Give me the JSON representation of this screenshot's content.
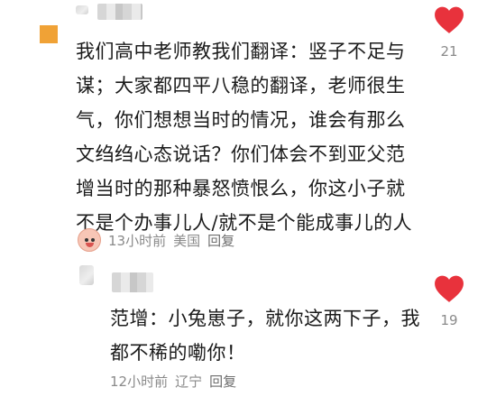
{
  "comments": [
    {
      "text": "我们高中老师教我们翻译：竖子不足与\n谋；大家都四平八稳的翻译，老师很生\n气，你们想想当时的情况，谁会有那么\n文绉绉心态说话？你们体会不到亚父范\n增当时的那种暴怒愤恨么，你这小子就\n不是个办事儿人/就不是个能成事儿的人",
      "time": "13小时前",
      "location": "美国",
      "reply_label": "回复",
      "likes": "21"
    },
    {
      "text": "范增：小兔崽子，就你这两下子，我\n都不稀的嘞你！",
      "time": "12小时前",
      "location": "辽宁",
      "reply_label": "回复",
      "likes": "19"
    }
  ],
  "colors": {
    "heart": "#e8323c",
    "badge": "#f0a236",
    "meta": "#8a8a8a"
  },
  "icons": {
    "like": "heart-icon",
    "sticker": "emoji-sticker-icon"
  }
}
